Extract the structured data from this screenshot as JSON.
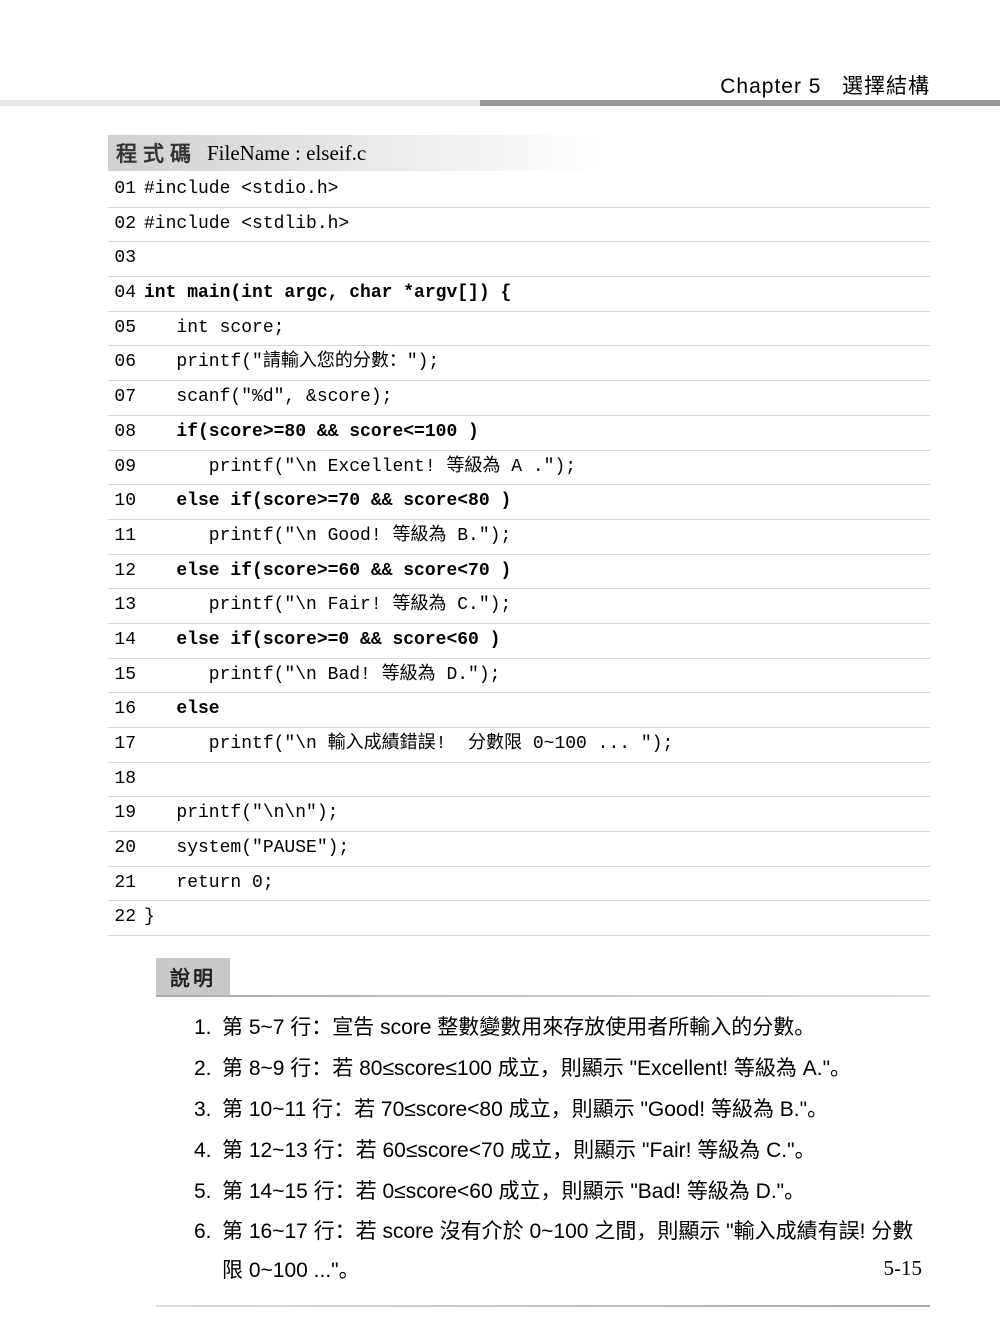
{
  "header": {
    "chapter": "Chapter 5",
    "title": "選擇結構"
  },
  "code_header": {
    "label": "程式碼",
    "filename_label": "FileName : elseif.c"
  },
  "code": [
    {
      "num": "01",
      "text": "#include <stdio.h>",
      "bold": false
    },
    {
      "num": "02",
      "text": "#include <stdlib.h>",
      "bold": false
    },
    {
      "num": "03",
      "text": "",
      "bold": false
    },
    {
      "num": "04",
      "text": "int main(int argc, char *argv[]) {",
      "bold": true
    },
    {
      "num": "05",
      "text": "   int score;",
      "bold": false
    },
    {
      "num": "06",
      "text": "   printf(\"請輸入您的分數：\");",
      "bold": false
    },
    {
      "num": "07",
      "text": "   scanf(\"%d\", &score);",
      "bold": false
    },
    {
      "num": "08",
      "text": "   if(score>=80 && score<=100 )",
      "bold": true
    },
    {
      "num": "09",
      "text": "      printf(\"\\n Excellent! 等級為 A .\");",
      "bold": false
    },
    {
      "num": "10",
      "text": "   else if(score>=70 && score<80 )",
      "bold": true
    },
    {
      "num": "11",
      "text": "      printf(\"\\n Good! 等級為 B.\");",
      "bold": false
    },
    {
      "num": "12",
      "text": "   else if(score>=60 && score<70 )",
      "bold": true
    },
    {
      "num": "13",
      "text": "      printf(\"\\n Fair! 等級為 C.\");",
      "bold": false
    },
    {
      "num": "14",
      "text": "   else if(score>=0 && score<60 )",
      "bold": true
    },
    {
      "num": "15",
      "text": "      printf(\"\\n Bad! 等級為 D.\");",
      "bold": false
    },
    {
      "num": "16",
      "text": "   else",
      "bold": true
    },
    {
      "num": "17",
      "text": "      printf(\"\\n 輸入成績錯誤!  分數限 0~100 ... \");",
      "bold": false
    },
    {
      "num": "18",
      "text": "",
      "bold": false
    },
    {
      "num": "19",
      "text": "   printf(\"\\n\\n\");",
      "bold": false
    },
    {
      "num": "20",
      "text": "   system(\"PAUSE\");",
      "bold": false
    },
    {
      "num": "21",
      "text": "   return 0;",
      "bold": false
    },
    {
      "num": "22",
      "text": "}",
      "bold": false
    }
  ],
  "explain": {
    "header": "說明",
    "items": [
      {
        "num": "1.",
        "text": "第 5~7 行：宣告 score 整數變數用來存放使用者所輸入的分數。"
      },
      {
        "num": "2.",
        "text": "第 8~9 行：若 80≤score≤100 成立，則顯示 \"Excellent! 等級為 A.\"。"
      },
      {
        "num": "3.",
        "text": "第 10~11 行：若 70≤score<80 成立，則顯示 \"Good! 等級為 B.\"。"
      },
      {
        "num": "4.",
        "text": "第 12~13 行：若 60≤score<70 成立，則顯示 \"Fair! 等級為 C.\"。"
      },
      {
        "num": "5.",
        "text": "第 14~15 行：若 0≤score<60 成立，則顯示 \"Bad! 等級為 D.\"。"
      },
      {
        "num": "6.",
        "text": "第 16~17 行：若 score 沒有介於 0~100 之間，則顯示 \"輸入成績有誤! 分數限 0~100 ...\"。"
      }
    ]
  },
  "page": "5-15"
}
